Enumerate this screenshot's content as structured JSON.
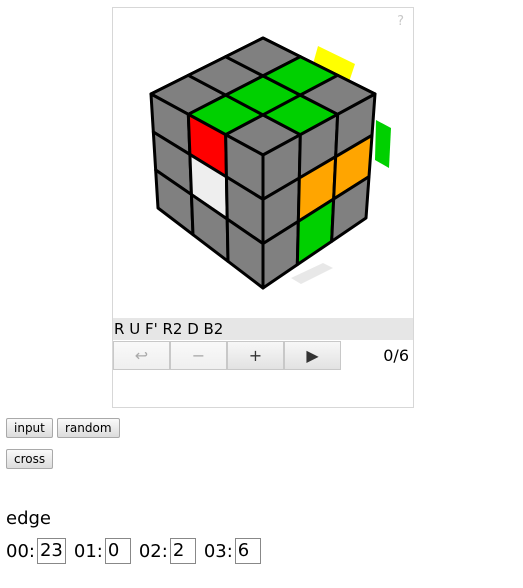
{
  "viewer": {
    "help_label": "?",
    "algorithm": "R U F' R2 D B2",
    "counter": "0/6",
    "controls": {
      "back_label": "↩",
      "minus_label": "−",
      "plus_label": "+",
      "play_label": "▶"
    },
    "colors": {
      "gray": "#808080",
      "green": "#00d000",
      "red": "#ff0000",
      "white": "#eeeeee",
      "orange": "#ffa500",
      "yellow": "#ffff00"
    }
  },
  "buttons": {
    "input_label": "input",
    "random_label": "random",
    "cross_label": "cross"
  },
  "edge": {
    "title": "edge",
    "items": [
      {
        "label": "00:",
        "value": "23"
      },
      {
        "label": "01:",
        "value": "0"
      },
      {
        "label": "02:",
        "value": "2"
      },
      {
        "label": "03:",
        "value": "6"
      }
    ]
  }
}
